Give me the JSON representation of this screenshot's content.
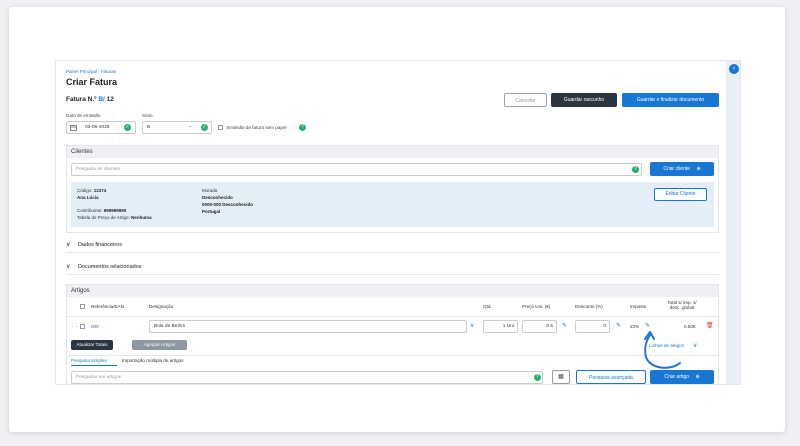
{
  "breadcrumb": {
    "home": "Painel Principal",
    "current": "Faturas"
  },
  "page_title": "Criar Fatura",
  "invoice": {
    "label": "Fatura N.º",
    "series": "B/",
    "number": "12"
  },
  "actions": {
    "cancel": "Cancelar",
    "save_draft": "Guardar rascunho",
    "save_finish": "Guardar e finalizar documento"
  },
  "issue_date": {
    "label": "Data de emissão",
    "value": "03-06-2025"
  },
  "series_select": {
    "label": "Série",
    "value": "B"
  },
  "paperless": {
    "label": "Emissão de fatura sem papel"
  },
  "clients": {
    "title": "Clientes",
    "search_placeholder": "Pesquisa de clientes",
    "create_button": "Criar cliente",
    "edit_button": "Editar Cliente",
    "code_label": "Código:",
    "code_value": "12374",
    "name": "Ana Lúcia",
    "taxpayer_label": "Contribuinte:",
    "taxpayer_value": "999999990",
    "price_table_label": "Tabela de Preço de Artigo:",
    "price_table_value": "Nenhuma",
    "address_label": "Morada",
    "address_line1": "Desconhecido",
    "address_line2": "0000-000 Desconhecido",
    "address_line3": "Portugal"
  },
  "financial_data": "Dados financeiros",
  "related_docs": "Documentos relacionados",
  "articles": {
    "title": "Artigos",
    "columns": {
      "ref": "Referência/EAN",
      "designation": "Designação",
      "qty": "Qtd.",
      "unit_price": "Preço Uni. (€)",
      "discount": "Desconto (%)",
      "tax": "Imposto",
      "total_1": "Total s/ imp. s/",
      "total_2": "desc. global"
    },
    "row": {
      "ref": "008",
      "designation": "Bola de Berlim",
      "qty": "1 Uni",
      "price": "0.5",
      "discount": "0",
      "tax": "23%",
      "total": "0.50€"
    },
    "update_totals": "Atualizar Totais",
    "group_articles": "Agrupar Artigos",
    "lines_label": "Linhas de artigos",
    "tab_simple": "Pesquisa simples",
    "tab_multiple": "Importação múltipla de artigos",
    "search_placeholder": "Pesquisar em artigos",
    "advanced_search": "Pesquisa avançada",
    "create_article": "Criar artigo"
  },
  "colors": {
    "accent": "#1976d2",
    "success": "#27b070",
    "dark": "#2c3441",
    "danger": "#e53935"
  }
}
